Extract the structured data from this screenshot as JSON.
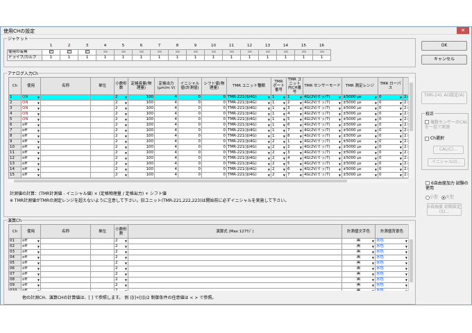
{
  "window": {
    "title": "使用CHの設定",
    "close_glyph": "✕"
  },
  "jacket": {
    "caption": "ジャケット",
    "numbers": [
      "1",
      "2",
      "3",
      "4",
      "5",
      "6",
      "7",
      "8",
      "9",
      "10",
      "11",
      "12",
      "13",
      "14",
      "15",
      "16"
    ],
    "row_labels": [
      "使用の有無",
      "ドライブ/カルブ"
    ],
    "checked": [
      true,
      true,
      true,
      false,
      false,
      false,
      false,
      false,
      false,
      false,
      false,
      false,
      false,
      false,
      false,
      false
    ],
    "drive_values": [
      "1",
      "1",
      "1",
      "1",
      "1",
      "1",
      "1",
      "1",
      "1",
      "1",
      "1",
      "1",
      "1",
      "1",
      "1",
      "1"
    ]
  },
  "buttons": {
    "ok": "OK",
    "cancel": "キャンセル",
    "tmr_ao": "TMR-241 AO設定(A)",
    "ch_select": "Ch選択",
    "cal": "CAL(C)...",
    "init": "イニシャル(I)...",
    "free_init": "6自由度 初期設定(S)..."
  },
  "side": {
    "calib_caption": "校正",
    "multi_sensor": "複数センサーのCALを一括で実施",
    "free_caption": "6自由度加力 試験の使用",
    "radio_small": "小型",
    "radio_large": "大型"
  },
  "analog": {
    "caption": "アナログ入力Ch",
    "headers": [
      "Ch",
      "使用",
      "名称",
      "単位",
      "小数桁数",
      "定格容量(物理量)",
      "定格出力(μm/m V)",
      "イニシャル値(計測値)",
      "シフト値(物理量)",
      "TMR ユニット種類",
      "TMR ポート番号",
      "TMR ユニット内CH番号",
      "TMR センサーモード",
      "TMR 測定レンジ",
      "TMR ローパス",
      "フ"
    ],
    "rows": [
      {
        "ch": "1",
        "use": "ON",
        "unit": "",
        "dec": "2",
        "cap": "100",
        "out": "4",
        "init": "0",
        "shift": "0",
        "tmr": "TMR-221(旧4G)",
        "port": "1",
        "inch": "1",
        "mode": "4G(2V/ミッ/7)",
        "range": "±5000 με",
        "lp": "0",
        "f": "2.0"
      },
      {
        "ch": "2",
        "use": "ON",
        "unit": "",
        "dec": "2",
        "cap": "100",
        "out": "4",
        "init": "0",
        "shift": "0",
        "tmr": "TMR-221(旧4G)",
        "port": "1",
        "inch": "2",
        "mode": "4G(2V/ミッ/7)",
        "range": "±5000 με",
        "lp": "0",
        "f": "2.0"
      },
      {
        "ch": "3",
        "use": "ON",
        "unit": "",
        "dec": "2",
        "cap": "100",
        "out": "4",
        "init": "0",
        "shift": "0",
        "tmr": "TMR-221(旧4G)",
        "port": "1",
        "inch": "3",
        "mode": "4G(2V/ミッ/7)",
        "range": "±5000 με",
        "lp": "0",
        "f": "2.0"
      },
      {
        "ch": "4",
        "use": "ON",
        "unit": "",
        "dec": "2",
        "cap": "100",
        "out": "4",
        "init": "0",
        "shift": "0",
        "tmr": "TMR-221(旧4G)",
        "port": "1",
        "inch": "4",
        "mode": "4G(2V/ミッ/7)",
        "range": "±5000 με",
        "lp": "0",
        "f": "2.0"
      },
      {
        "ch": "5",
        "use": "ON",
        "unit": "",
        "dec": "2",
        "cap": "100",
        "out": "4",
        "init": "0",
        "shift": "0",
        "tmr": "TMR-221(旧4G)",
        "port": "1",
        "inch": "5",
        "mode": "4G(2V/ミッ/7)",
        "range": "±5000 με",
        "lp": "0",
        "f": "2.0"
      },
      {
        "ch": "6",
        "use": "off",
        "unit": "",
        "dec": "2",
        "cap": "100",
        "out": "4",
        "init": "0",
        "shift": "0",
        "tmr": "TMR-221(旧4G)",
        "port": "1",
        "inch": "6",
        "mode": "4G(2V/ミッ/7)",
        "range": "±5000 με",
        "lp": "0",
        "f": "2.0"
      },
      {
        "ch": "7",
        "use": "off",
        "unit": "",
        "dec": "2",
        "cap": "100",
        "out": "4",
        "init": "0",
        "shift": "0",
        "tmr": "TMR-221(旧4G)",
        "port": "1",
        "inch": "7",
        "mode": "4G(2V/ミッ/7)",
        "range": "±5000 με",
        "lp": "0",
        "f": "2.0"
      },
      {
        "ch": "8",
        "use": "off",
        "unit": "",
        "dec": "2",
        "cap": "100",
        "out": "4",
        "init": "0",
        "shift": "0",
        "tmr": "TMR-221(旧4G)",
        "port": "1",
        "inch": "8",
        "mode": "4G(2V/ミッ/7)",
        "range": "±5000 με",
        "lp": "0",
        "f": "2.0"
      },
      {
        "ch": "9",
        "use": "off",
        "unit": "",
        "dec": "2",
        "cap": "100",
        "out": "4",
        "init": "0",
        "shift": "0",
        "tmr": "TMR-221(旧4G)",
        "port": "2",
        "inch": "1",
        "mode": "4G(2V/ミッ/7)",
        "range": "±5000 με",
        "lp": "0",
        "f": "2.0"
      },
      {
        "ch": "10",
        "use": "off",
        "unit": "",
        "dec": "2",
        "cap": "100",
        "out": "4",
        "init": "0",
        "shift": "0",
        "tmr": "TMR-221(旧4G)",
        "port": "2",
        "inch": "2",
        "mode": "4G(2V/ミッ/7)",
        "range": "±5000 με",
        "lp": "0",
        "f": "2.0"
      },
      {
        "ch": "11",
        "use": "off",
        "unit": "",
        "dec": "2",
        "cap": "100",
        "out": "4",
        "init": "0",
        "shift": "0",
        "tmr": "TMR-221(旧4G)",
        "port": "2",
        "inch": "3",
        "mode": "4G(2V/ミッ/7)",
        "range": "±5000 με",
        "lp": "0",
        "f": "2.0"
      },
      {
        "ch": "12",
        "use": "off",
        "unit": "",
        "dec": "2",
        "cap": "100",
        "out": "4",
        "init": "0",
        "shift": "0",
        "tmr": "TMR-221(旧4G)",
        "port": "2",
        "inch": "4",
        "mode": "4G(2V/ミッ/7)",
        "range": "±5000 με",
        "lp": "0",
        "f": "2.0"
      },
      {
        "ch": "13",
        "use": "off",
        "unit": "",
        "dec": "2",
        "cap": "100",
        "out": "4",
        "init": "0",
        "shift": "0",
        "tmr": "TMR-221(旧4G)",
        "port": "2",
        "inch": "5",
        "mode": "4G(2V/ミッ/7)",
        "range": "±5000 με",
        "lp": "0",
        "f": "2.0"
      },
      {
        "ch": "14",
        "use": "off",
        "unit": "",
        "dec": "2",
        "cap": "100",
        "out": "4",
        "init": "0",
        "shift": "0",
        "tmr": "TMR-221(旧4G)",
        "port": "2",
        "inch": "6",
        "mode": "4G(2V/ミッ/7)",
        "range": "±5000 με",
        "lp": "0",
        "f": "2.0"
      },
      {
        "ch": "15",
        "use": "off",
        "unit": "",
        "dec": "2",
        "cap": "100",
        "out": "4",
        "init": "0",
        "shift": "0",
        "tmr": "TMR-221(旧4G)",
        "port": "2",
        "inch": "7",
        "mode": "4G(2V/ミッ/7)",
        "range": "±5000 με",
        "lp": "0",
        "f": "2.0"
      }
    ],
    "formula_line1": "計測値の計算：(TMR計測値 - イニシャル値) × (定格物理量 / 定格出力) + シフト値",
    "formula_line2": "※ TMR計測値がTMRの測定レンジを超えないように注意して下さい。旧ユニット(TMR-221,222,223)は開始前に必ずイニシャルを実施して下さい。"
  },
  "calc": {
    "caption": "演算Ch",
    "headers": [
      "Ch",
      "使用",
      "名称",
      "単位",
      "小数桁数",
      "演算式 (Max 127ﾓｼﾞ)",
      "計測値文字色",
      "計測値背景色"
    ],
    "rows": [
      {
        "ch": "01",
        "use": "off",
        "dec": "2",
        "fg": "黒",
        "bg": "水色"
      },
      {
        "ch": "02",
        "use": "off",
        "dec": "2",
        "fg": "黒",
        "bg": "水色"
      },
      {
        "ch": "03",
        "use": "off",
        "dec": "2",
        "fg": "黒",
        "bg": "水色"
      },
      {
        "ch": "04",
        "use": "off",
        "dec": "2",
        "fg": "黒",
        "bg": "水色"
      },
      {
        "ch": "05",
        "use": "off",
        "dec": "2",
        "fg": "黒",
        "bg": "水色"
      },
      {
        "ch": "06",
        "use": "off",
        "dec": "2",
        "fg": "黒",
        "bg": "水色"
      },
      {
        "ch": "07",
        "use": "off",
        "dec": "2",
        "fg": "黒",
        "bg": "水色"
      },
      {
        "ch": "08",
        "use": "off",
        "dec": "2",
        "fg": "黒",
        "bg": "水色"
      },
      {
        "ch": "09",
        "use": "off",
        "dec": "2",
        "fg": "黒",
        "bg": "水色"
      },
      {
        "ch": "010",
        "use": "off",
        "dec": "2",
        "fg": "黒",
        "bg": "水色"
      }
    ],
    "footer": "他の計測CH、演算CHの計算値は、[ ] で参照します。 例 ([I]+[I])/2   制御条件の任意値は < > で参照。"
  },
  "colors": {
    "selected_row": "#00ffff",
    "on_text": "#e00000",
    "bg_color_text": "#0050ff"
  }
}
